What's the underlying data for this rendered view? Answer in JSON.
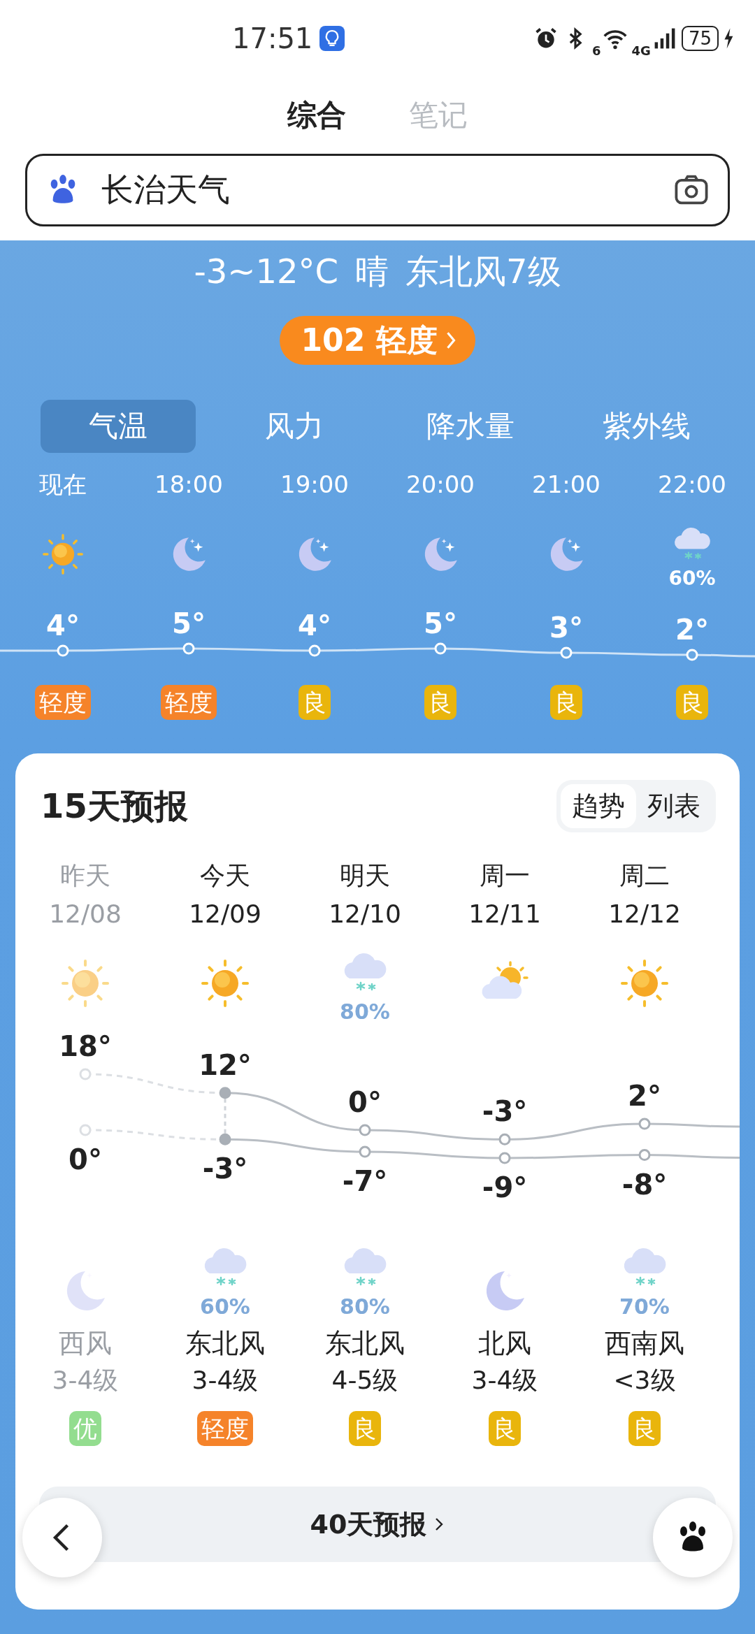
{
  "status_bar": {
    "time": "17:51",
    "wifi_label": "6",
    "network": "4G",
    "battery": "75"
  },
  "tabs": [
    {
      "label": "综合",
      "selected": true
    },
    {
      "label": "笔记",
      "selected": false
    }
  ],
  "search": {
    "value": "长治天气"
  },
  "summary": {
    "temp_range": "-3~12°C",
    "condition": "晴",
    "wind": "东北风7级"
  },
  "aqi_button": {
    "label": "102 轻度"
  },
  "metric_tabs": [
    {
      "label": "气温",
      "selected": true
    },
    {
      "label": "风力",
      "selected": false
    },
    {
      "label": "降水量",
      "selected": false
    },
    {
      "label": "紫外线",
      "selected": false
    }
  ],
  "hourly": [
    {
      "time": "现在",
      "kind": "sun",
      "temp": "4°",
      "aqi": "轻度",
      "color": "#f5832a"
    },
    {
      "time": "18:00",
      "kind": "moon",
      "temp": "5°",
      "aqi": "轻度",
      "color": "#f5832a"
    },
    {
      "time": "19:00",
      "kind": "moon",
      "temp": "4°",
      "aqi": "良",
      "color": "#e9b50c"
    },
    {
      "time": "20:00",
      "kind": "moon",
      "temp": "5°",
      "aqi": "良",
      "color": "#e9b50c"
    },
    {
      "time": "21:00",
      "kind": "moon",
      "temp": "3°",
      "aqi": "良",
      "color": "#e9b50c"
    },
    {
      "time": "22:00",
      "kind": "snow-cloud",
      "precip": "60%",
      "temp": "2°",
      "aqi": "良",
      "color": "#e9b50c"
    }
  ],
  "forecast": {
    "title": "15天预报",
    "view_tabs": [
      {
        "label": "趋势",
        "selected": true
      },
      {
        "label": "列表",
        "selected": false
      }
    ],
    "days": [
      {
        "day": "昨天",
        "date": "12/08",
        "past": true,
        "today": false,
        "daytime": {
          "kind": "sun"
        },
        "high": "18°",
        "low": "0°",
        "night": {
          "kind": "moon"
        },
        "wind_dir": "西风",
        "wind_level": "3-4级",
        "aqi": "优",
        "color": "#93dd8f"
      },
      {
        "day": "今天",
        "date": "12/09",
        "past": false,
        "today": true,
        "daytime": {
          "kind": "sun"
        },
        "high": "12°",
        "low": "-3°",
        "night": {
          "kind": "snow-cloud",
          "precip": "60%"
        },
        "wind_dir": "东北风",
        "wind_level": "3-4级",
        "aqi": "轻度",
        "color": "#f5832a"
      },
      {
        "day": "明天",
        "date": "12/10",
        "past": false,
        "today": false,
        "daytime": {
          "kind": "snow-cloud",
          "precip": "80%"
        },
        "high": "0°",
        "low": "-7°",
        "night": {
          "kind": "snow-cloud",
          "precip": "80%"
        },
        "wind_dir": "东北风",
        "wind_level": "4-5级",
        "aqi": "良",
        "color": "#e9b50c"
      },
      {
        "day": "周一",
        "date": "12/11",
        "past": false,
        "today": false,
        "daytime": {
          "kind": "partly-cloudy"
        },
        "high": "-3°",
        "low": "-9°",
        "night": {
          "kind": "moon"
        },
        "wind_dir": "北风",
        "wind_level": "3-4级",
        "aqi": "良",
        "color": "#e9b50c"
      },
      {
        "day": "周二",
        "date": "12/12",
        "past": false,
        "today": false,
        "daytime": {
          "kind": "sun"
        },
        "high": "2°",
        "low": "-8°",
        "night": {
          "kind": "snow-cloud",
          "precip": "70%"
        },
        "wind_dir": "西南风",
        "wind_level": "<3级",
        "aqi": "良",
        "color": "#e9b50c"
      }
    ],
    "more_button": "40天预报"
  }
}
